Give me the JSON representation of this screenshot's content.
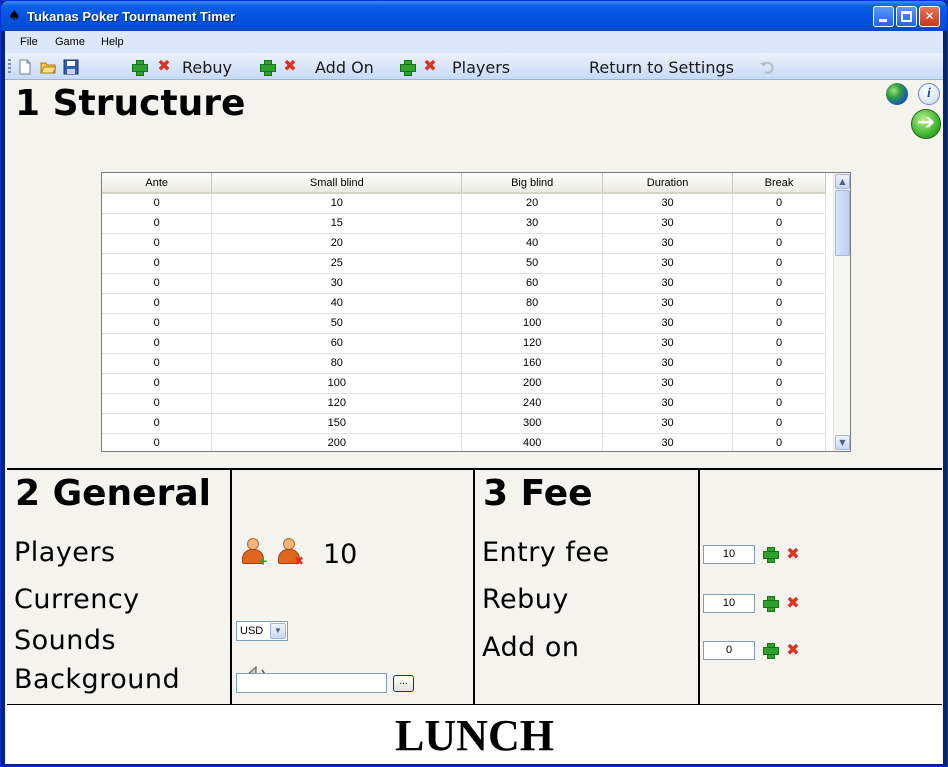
{
  "window": {
    "title": "Tukanas Poker Tournament Timer"
  },
  "menu": [
    "File",
    "Game",
    "Help"
  ],
  "toolbar": {
    "rebuy_label": "Rebuy",
    "addon_label": "Add On",
    "players_label": "Players",
    "return_label": "Return to Settings"
  },
  "structure": {
    "heading": "1 Structure",
    "columns": [
      "Ante",
      "Small blind",
      "Big blind",
      "Duration",
      "Break"
    ],
    "rows": [
      [
        "0",
        "10",
        "20",
        "30",
        "0"
      ],
      [
        "0",
        "15",
        "30",
        "30",
        "0"
      ],
      [
        "0",
        "20",
        "40",
        "30",
        "0"
      ],
      [
        "0",
        "25",
        "50",
        "30",
        "0"
      ],
      [
        "0",
        "30",
        "60",
        "30",
        "0"
      ],
      [
        "0",
        "40",
        "80",
        "30",
        "0"
      ],
      [
        "0",
        "50",
        "100",
        "30",
        "0"
      ],
      [
        "0",
        "60",
        "120",
        "30",
        "0"
      ],
      [
        "0",
        "80",
        "160",
        "30",
        "0"
      ],
      [
        "0",
        "100",
        "200",
        "30",
        "0"
      ],
      [
        "0",
        "120",
        "240",
        "30",
        "0"
      ],
      [
        "0",
        "150",
        "300",
        "30",
        "0"
      ],
      [
        "0",
        "200",
        "400",
        "30",
        "0"
      ]
    ]
  },
  "general": {
    "heading": "2 General",
    "players_label": "Players",
    "players_count": "10",
    "currency_label": "Currency",
    "currency_value": "USD",
    "sounds_label": "Sounds",
    "background_label": "Background",
    "background_value": "",
    "browse_label": "..."
  },
  "fee": {
    "heading": "3 Fee",
    "entry_label": "Entry fee",
    "entry_value": "10",
    "rebuy_label": "Rebuy",
    "rebuy_value": "10",
    "addon_label": "Add on",
    "addon_value": "0"
  },
  "status": {
    "break_text": "LUNCH"
  },
  "colors": {
    "title_bar": "#0454e0",
    "plus": "#2da32d",
    "cross": "#e0301e"
  }
}
